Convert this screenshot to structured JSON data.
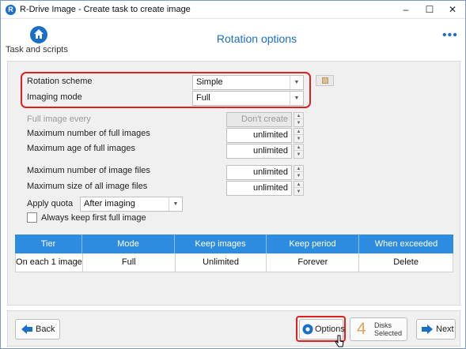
{
  "window": {
    "title": "R-Drive Image - Create task to create image",
    "minimize_glyph": "–",
    "maximize_glyph": "☐",
    "close_glyph": "✕"
  },
  "header": {
    "home_label": "Task and scripts",
    "page_title": "Rotation options",
    "more_glyph": "•••"
  },
  "rotation": {
    "scheme_label": "Rotation scheme",
    "scheme_value": "Simple",
    "imaging_label": "Imaging mode",
    "imaging_value": "Full"
  },
  "fields": {
    "full_every_label": "Full image every",
    "full_every_value": "Don't create",
    "max_full_label": "Maximum number of full images",
    "max_full_value": "unlimited",
    "max_age_label": "Maximum age of full images",
    "max_age_value": "unlimited",
    "max_files_label": "Maximum number of image files",
    "max_files_value": "unlimited",
    "max_size_label": "Maximum size of all image files",
    "max_size_value": "unlimited",
    "quota_label": "Apply quota",
    "quota_value": "After imaging",
    "keep_first_label": "Always keep first full image",
    "keep_first_checked": false
  },
  "table": {
    "headers": [
      "Tier",
      "Mode",
      "Keep images",
      "Keep period",
      "When exceeded"
    ],
    "rows": [
      [
        "On each 1 image",
        "Full",
        "Unlimited",
        "Forever",
        "Delete"
      ]
    ]
  },
  "footer": {
    "back_label": "Back",
    "options_label": "Options",
    "disks_count": "4",
    "disks_line1": "Disks",
    "disks_line2": "Selected",
    "next_label": "Next"
  },
  "colors": {
    "accent": "#1a6fc9",
    "table_header": "#2d8ce0",
    "highlight": "#e02020"
  }
}
